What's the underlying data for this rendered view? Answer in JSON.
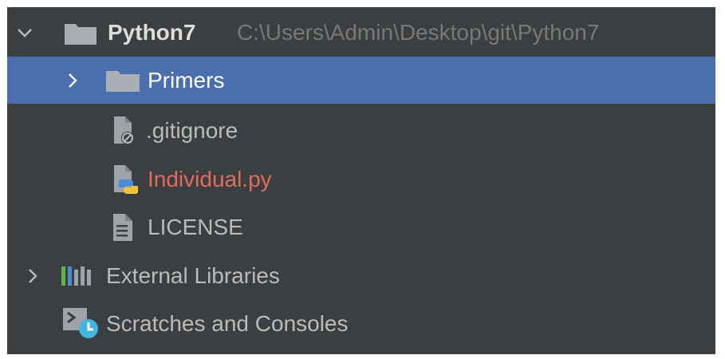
{
  "project": {
    "name": "Python7",
    "path": "C:\\Users\\Admin\\Desktop\\git\\Python7"
  },
  "tree": {
    "primers": "Primers",
    "gitignore": ".gitignore",
    "individual": "Individual.py",
    "license": "LICENSE",
    "external": "External Libraries",
    "scratches": "Scratches and Consoles"
  },
  "colors": {
    "background": "#3c3f41",
    "selection": "#4b6eaf",
    "text": "#bbbbbb",
    "modified_file": "#e06c5b",
    "path_text": "#787878",
    "folder": "#a9aeb4"
  },
  "icons": {
    "expanded": "chevron-down-icon",
    "collapsed": "chevron-right-icon",
    "folder": "folder-icon",
    "ignored_file": "ignored-file-icon",
    "python_file": "python-file-icon",
    "text_file": "text-file-icon",
    "libraries": "libraries-icon",
    "scratches": "scratches-consoles-icon"
  }
}
